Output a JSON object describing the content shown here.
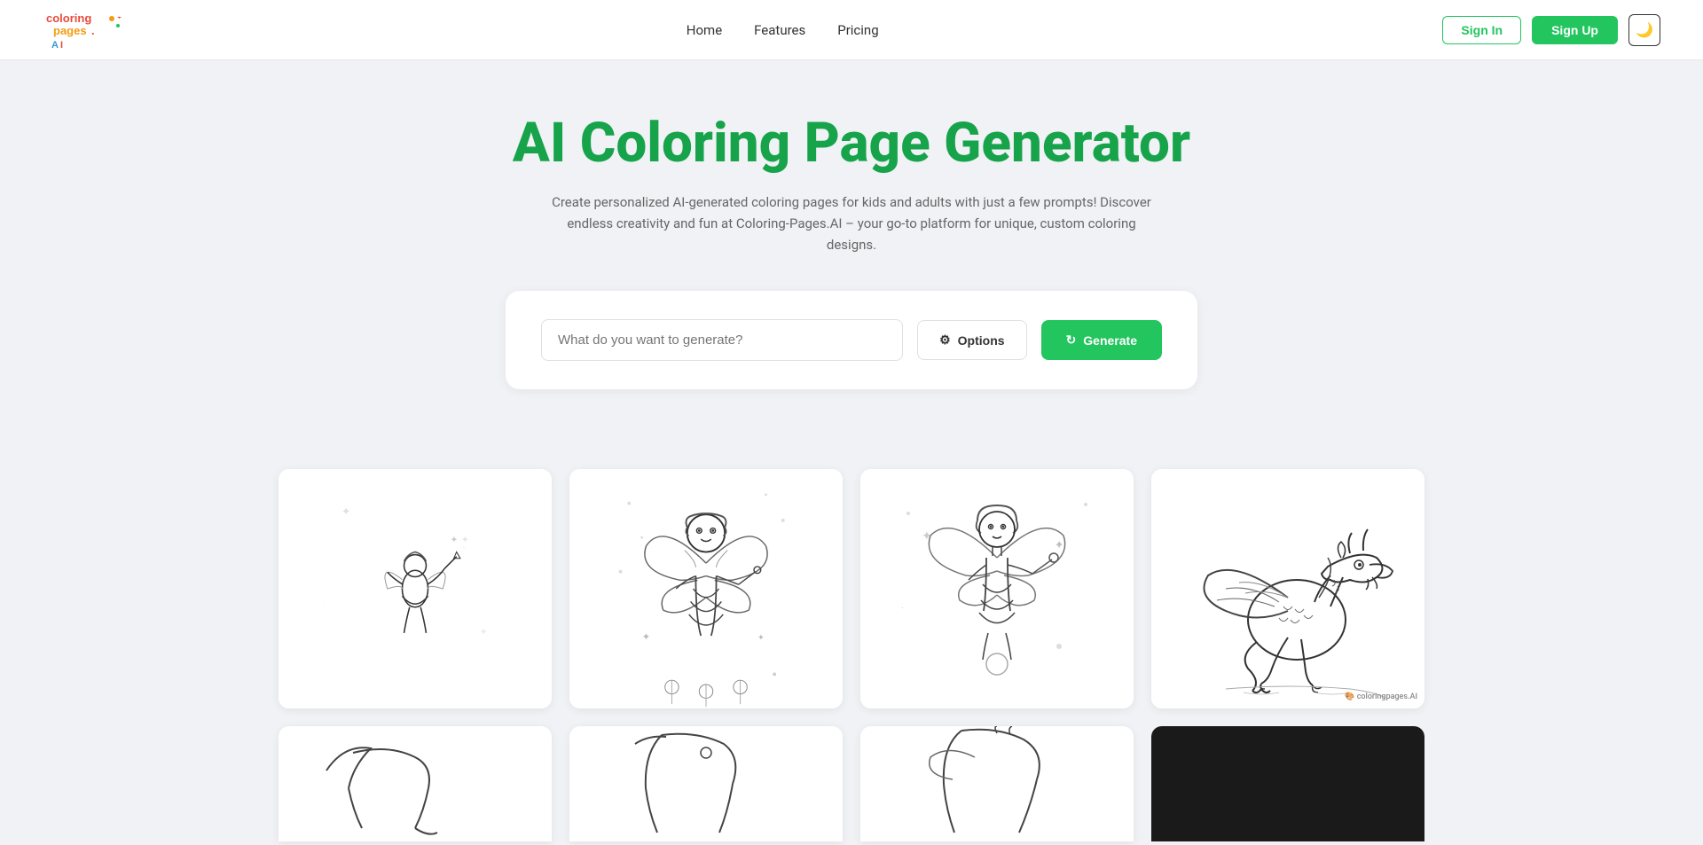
{
  "navbar": {
    "logo_alt": "Coloring Pages AI",
    "nav_items": [
      {
        "label": "Home",
        "href": "#"
      },
      {
        "label": "Features",
        "href": "#"
      },
      {
        "label": "Pricing",
        "href": "#"
      }
    ],
    "signin_label": "Sign In",
    "signup_label": "Sign Up",
    "theme_icon": "🌙"
  },
  "hero": {
    "title": "AI Coloring Page Generator",
    "subtitle": "Create personalized AI-generated coloring pages for kids and adults with just a few prompts! Discover endless creativity and fun at Coloring-Pages.AI – your go-to platform for unique, custom coloring designs."
  },
  "generator": {
    "placeholder": "What do you want to generate?",
    "options_label": "Options",
    "generate_label": "Generate",
    "gear_icon": "⚙",
    "refresh_icon": "↻"
  },
  "gallery": {
    "items": [
      {
        "id": "fairy-small",
        "alt": "Small fairy coloring page"
      },
      {
        "id": "fairy-large",
        "alt": "Large fairy with butterfly wings coloring page"
      },
      {
        "id": "fairy-magic",
        "alt": "Magic fairy coloring page"
      },
      {
        "id": "dragon",
        "alt": "Dragon coloring page",
        "watermark": "coloringpages.AI"
      }
    ],
    "bottom_items": [
      {
        "id": "dragon-partial-1",
        "alt": "Dragon partial coloring page"
      },
      {
        "id": "dragon-partial-2",
        "alt": "Dragon partial coloring page 2"
      },
      {
        "id": "dragon-partial-3",
        "alt": "Dragon partial coloring page 3"
      },
      {
        "id": "dark-panel",
        "alt": "Dark panel"
      }
    ]
  }
}
